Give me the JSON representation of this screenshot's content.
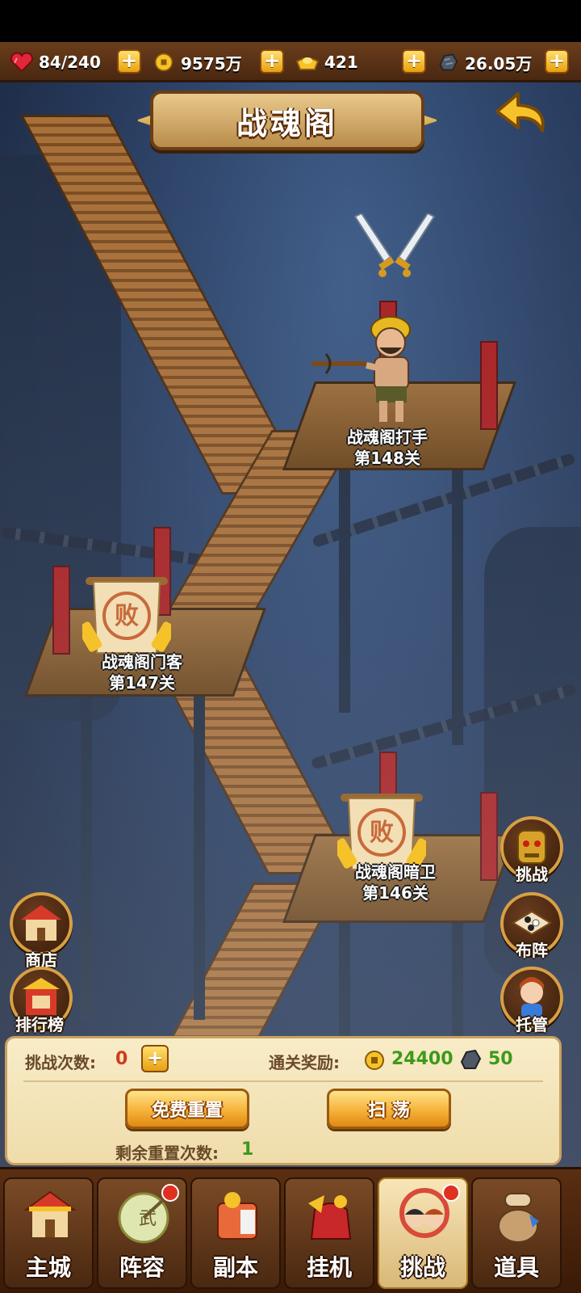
{
  "resources": {
    "stamina": "84/240",
    "coins": "9575万",
    "ingots": "421",
    "ore": "26.05万"
  },
  "title": "战魂阁",
  "stages": [
    {
      "name": "战魂阁打手",
      "level": "第148关",
      "status": "current"
    },
    {
      "name": "战魂阁门客",
      "level": "第147关",
      "status": "defeated",
      "stamp": "败"
    },
    {
      "name": "战魂阁暗卫",
      "level": "第146关",
      "status": "defeated",
      "stamp": "败"
    }
  ],
  "side_buttons": {
    "shop": "商店",
    "ranking": "排行榜",
    "challenge": "挑战",
    "formation": "布阵",
    "auto": "托管"
  },
  "panel": {
    "challenge_count_label": "挑战次数:",
    "challenge_count": "0",
    "reward_label": "通关奖励:",
    "reward_coins": "24400",
    "reward_ore": "50",
    "free_reset": "免费重置",
    "sweep": "扫 荡",
    "remaining_reset_label": "剩余重置次数:",
    "remaining_reset": "1"
  },
  "nav": [
    {
      "label": "主城",
      "badge": false
    },
    {
      "label": "阵容",
      "badge": true
    },
    {
      "label": "副本",
      "badge": false
    },
    {
      "label": "挂机",
      "badge": false
    },
    {
      "label": "挑战",
      "badge": true,
      "active": true
    },
    {
      "label": "道具",
      "badge": false
    }
  ],
  "colors": {
    "accent_gold": "#f5b23a",
    "panel_bg": "#f8ecc8",
    "red_text": "#d23a1a",
    "green_text": "#3c9a1a"
  }
}
